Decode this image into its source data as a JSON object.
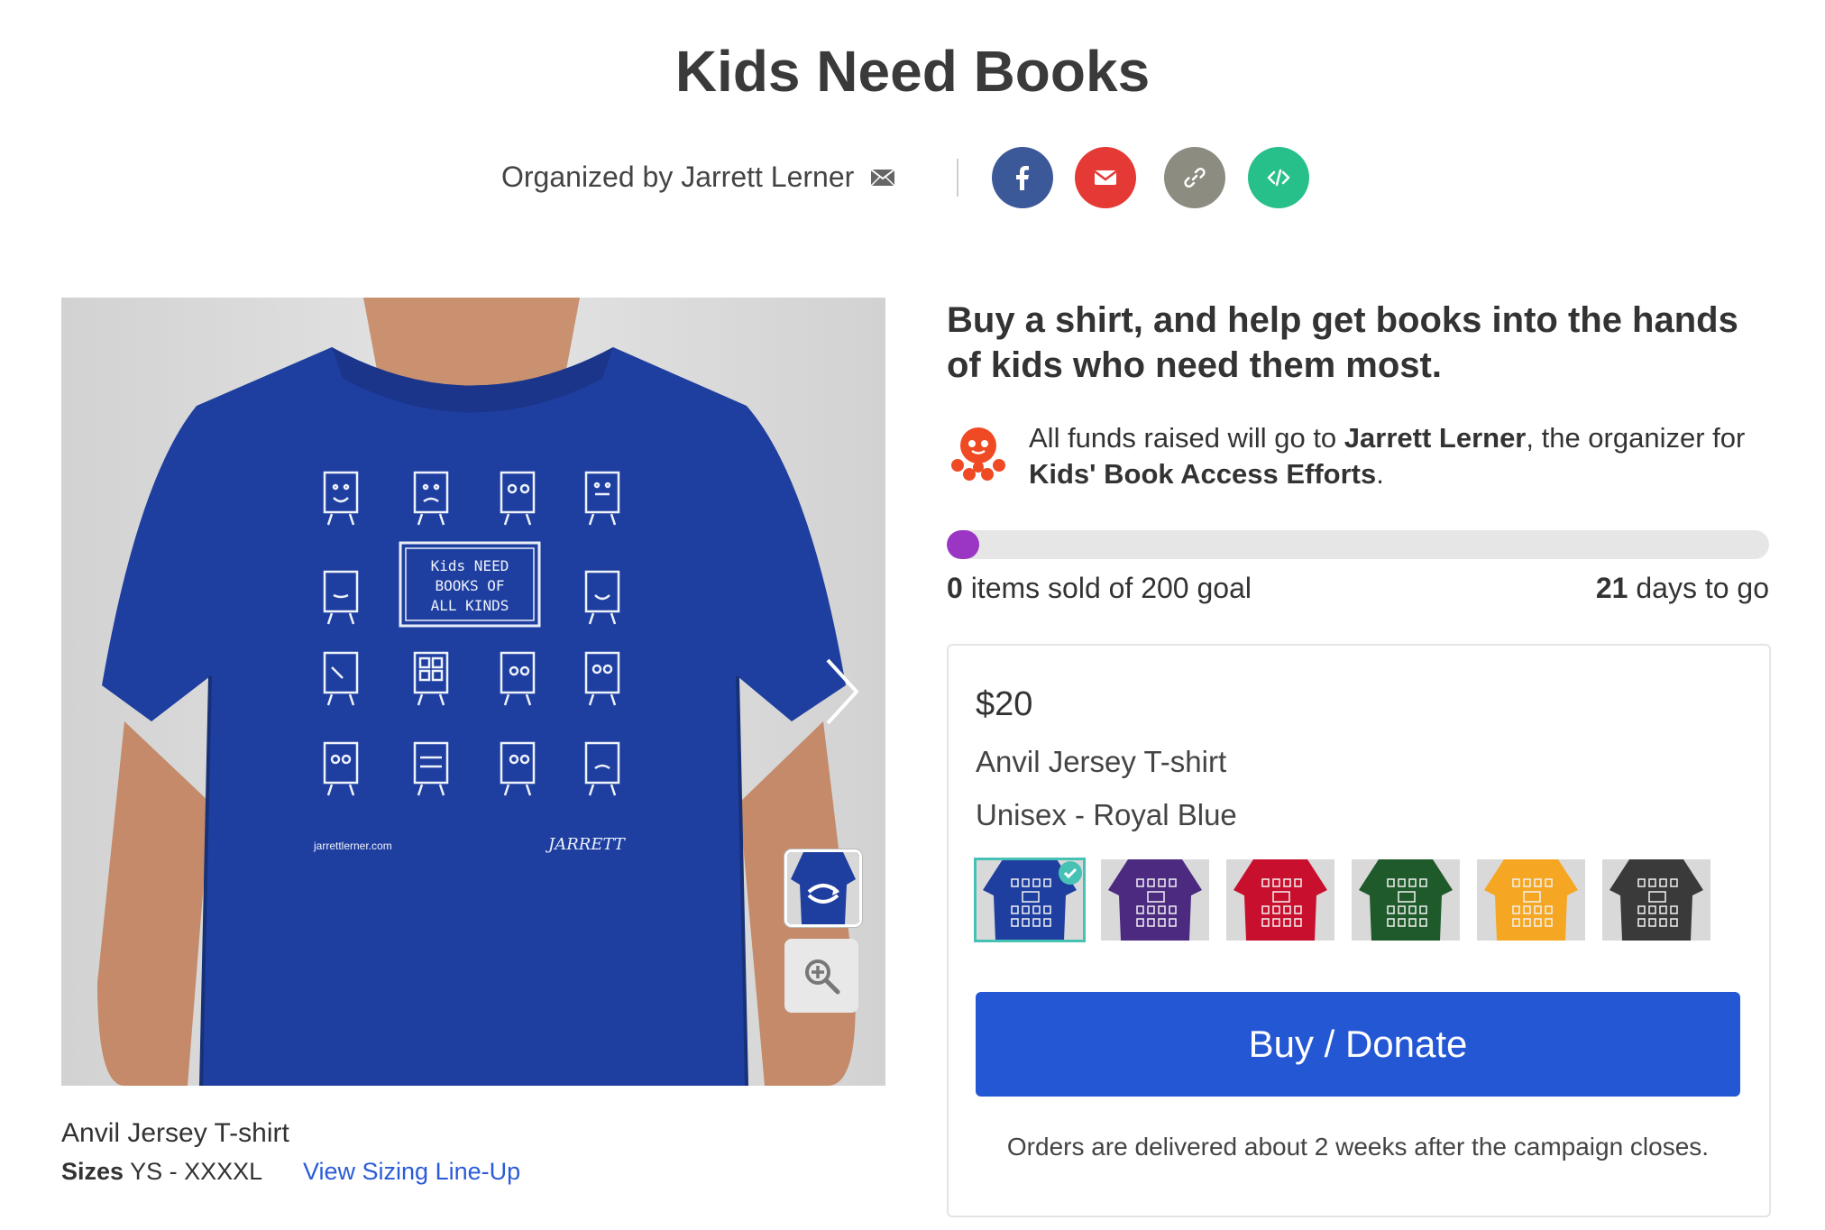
{
  "title": "Kids Need Books",
  "organizer": {
    "label": "Organized by Jarrett Lerner"
  },
  "share": [
    {
      "name": "facebook",
      "icon": "facebook-icon",
      "color": "#3b5998"
    },
    {
      "name": "email",
      "icon": "mail-icon",
      "color": "#e53935"
    },
    {
      "name": "link",
      "icon": "link-icon",
      "color": "#8d8c80"
    },
    {
      "name": "embed",
      "icon": "code-icon",
      "color": "#27c08b"
    }
  ],
  "product": {
    "shirt_text_lines": [
      "Kids NEED",
      "BOOKS OF",
      "ALL KINDS"
    ],
    "shirt_site": "jarrettlerner.com",
    "shirt_signature": "JARRETT",
    "name": "Anvil Jersey T-shirt",
    "sizes_label": "Sizes",
    "sizes_value": "YS - XXXXL",
    "sizing_link": "View Sizing Line-Up"
  },
  "campaign": {
    "headline": "Buy a shirt, and help get books into the hands of kids who need them most.",
    "funds_prefix": "All funds raised will go to ",
    "funds_recipient": "Jarrett Lerner",
    "funds_middle": ", the organizer for ",
    "funds_cause": "Kids' Book Access Efforts",
    "funds_suffix": ".",
    "progress_fraction": 0,
    "sold_count": "0",
    "sold_label": " items sold of 200 goal",
    "days_count": "21",
    "days_label": " days to go"
  },
  "card": {
    "price": "$20",
    "style": "Anvil Jersey T-shirt",
    "color": "Unisex - Royal Blue",
    "swatches": [
      {
        "name": "royal-blue",
        "color": "#1f3fa0",
        "selected": true
      },
      {
        "name": "purple",
        "color": "#4b2a80",
        "selected": false
      },
      {
        "name": "red",
        "color": "#c8102e",
        "selected": false
      },
      {
        "name": "forest-green",
        "color": "#1f5a2a",
        "selected": false
      },
      {
        "name": "gold",
        "color": "#f5a623",
        "selected": false
      },
      {
        "name": "charcoal",
        "color": "#3a3a3a",
        "selected": false
      }
    ],
    "buy_label": "Buy / Donate",
    "orders_note": "Orders are delivered about 2 weeks after the campaign closes."
  }
}
